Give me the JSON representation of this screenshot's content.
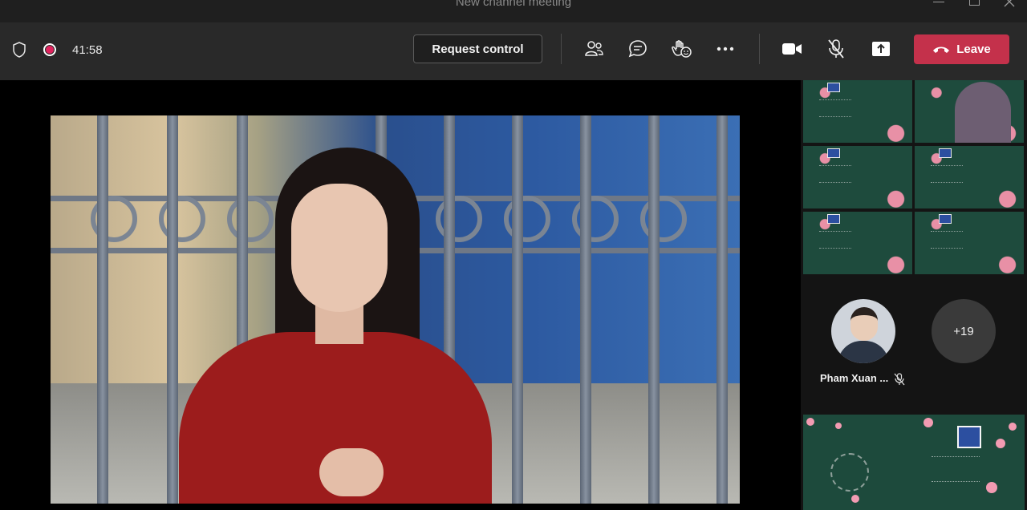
{
  "window": {
    "title": "New channel meeting"
  },
  "toolbar": {
    "timer": "41:58",
    "request_control_label": "Request control",
    "leave_label": "Leave",
    "accent_color": "#c4314b"
  },
  "participants": {
    "featured_name": "Pham Xuan ...",
    "overflow_count": "+19"
  },
  "icons": {
    "security": "shield-icon",
    "recording": "record-icon",
    "people": "people-icon",
    "chat": "chat-icon",
    "reactions": "reaction-icon",
    "more": "more-icon",
    "camera": "camera-icon",
    "mic": "mic-off-icon",
    "share": "share-icon"
  }
}
